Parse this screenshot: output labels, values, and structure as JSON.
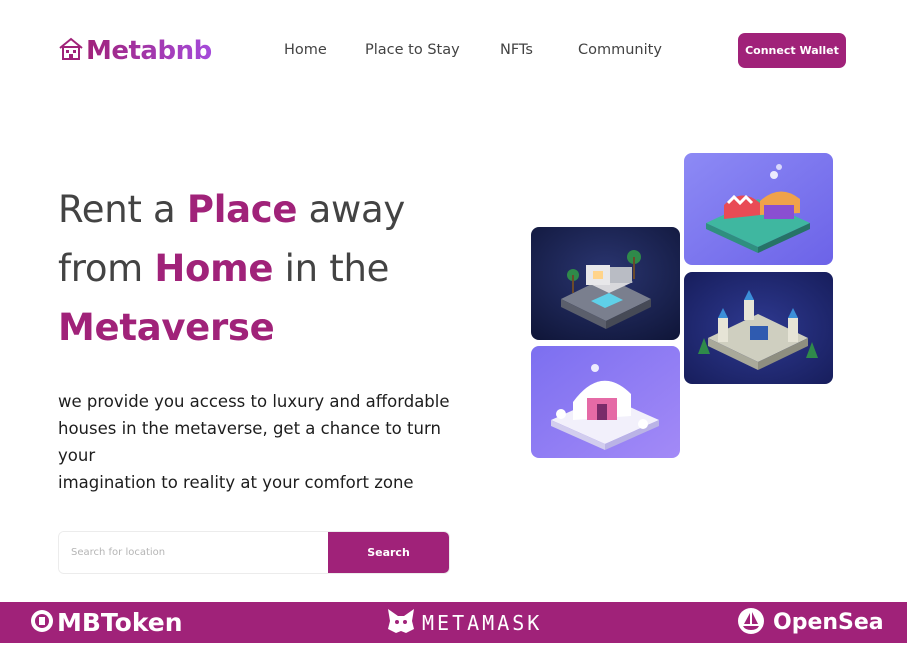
{
  "brand": {
    "name": "Metabnb",
    "icon": "house-icon"
  },
  "nav": {
    "items": [
      {
        "label": "Home"
      },
      {
        "label": "Place to Stay"
      },
      {
        "label": "NFTs"
      },
      {
        "label": "Community"
      }
    ],
    "connect_label": "Connect Wallet"
  },
  "hero": {
    "line1_a": "Rent a ",
    "line1_b": "Place",
    "line1_c": " away",
    "line2_a": "from ",
    "line2_b": "Home",
    "line2_c": " in the",
    "line3": "Metaverse",
    "description": "we provide you access to luxury and affordable\nhouses in the metaverse, get a chance to turn\nyour\nimagination to reality at your comfort zone"
  },
  "search": {
    "placeholder": "Search for location",
    "button_label": "Search"
  },
  "gallery": {
    "items": [
      {
        "name": "modern-villa-image"
      },
      {
        "name": "market-stall-image"
      },
      {
        "name": "castle-image"
      },
      {
        "name": "snow-cottage-image"
      }
    ]
  },
  "partners": {
    "items": [
      {
        "label": "MBToken",
        "icon": "mbtoken-icon"
      },
      {
        "label": "METAMASK",
        "icon": "fox-icon"
      },
      {
        "label": "OpenSea",
        "icon": "sailboat-icon"
      }
    ]
  },
  "colors": {
    "primary": "#a02279",
    "text": "#434343",
    "gradient_end": "#a54bdb"
  }
}
